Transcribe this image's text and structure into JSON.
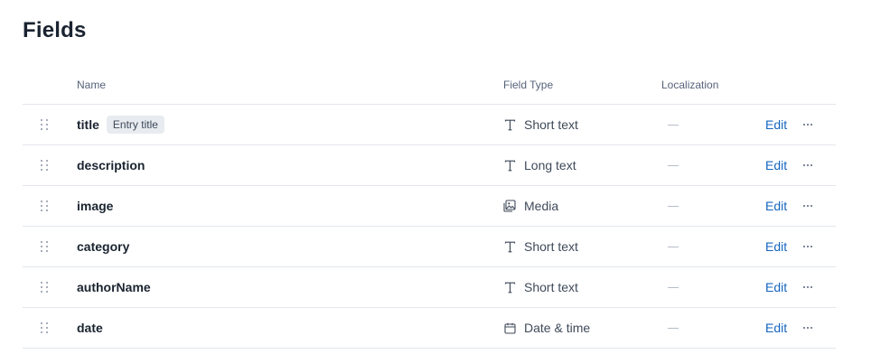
{
  "page": {
    "title": "Fields"
  },
  "table": {
    "headers": {
      "name": "Name",
      "field_type": "Field Type",
      "localization": "Localization"
    },
    "edit_label": "Edit",
    "rows": [
      {
        "name": "title",
        "badge": "Entry title",
        "type": "Short text",
        "type_icon": "text-icon",
        "localization": "—"
      },
      {
        "name": "description",
        "badge": "",
        "type": "Long text",
        "type_icon": "text-icon",
        "localization": "—"
      },
      {
        "name": "image",
        "badge": "",
        "type": "Media",
        "type_icon": "media-icon",
        "localization": "—"
      },
      {
        "name": "category",
        "badge": "",
        "type": "Short text",
        "type_icon": "text-icon",
        "localization": "—"
      },
      {
        "name": "authorName",
        "badge": "",
        "type": "Short text",
        "type_icon": "text-icon",
        "localization": "—"
      },
      {
        "name": "date",
        "badge": "",
        "type": "Date & time",
        "type_icon": "calendar-icon",
        "localization": "—"
      }
    ]
  },
  "colors": {
    "link": "#1565c0",
    "badge_bg": "#e8ebef",
    "divider": "#e3e7ec"
  }
}
